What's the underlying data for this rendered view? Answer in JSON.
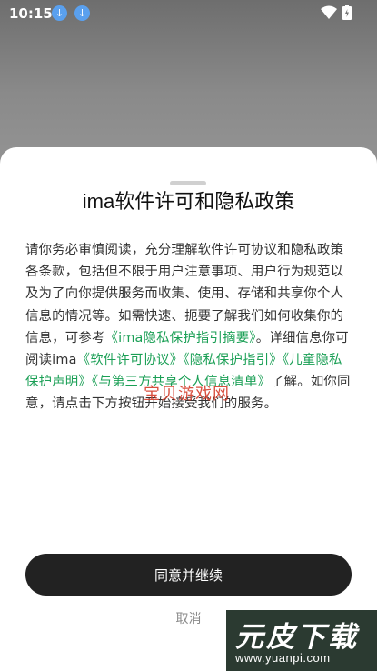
{
  "status_bar": {
    "time": "10:15",
    "icons": [
      "download-icon",
      "download-icon",
      "wifi-icon",
      "battery-icon"
    ]
  },
  "dialog": {
    "title": "ima软件许可和隐私政策",
    "body": {
      "intro": "请你务必审慎阅读，充分理解软件许可协议和隐私政策各条款，包括但不限于用户注意事项、用户行为规范以及为了向你提供服务而收集、使用、存储和共享你个人信息的情况等。如需快速、扼要了解我们如何收集你的信息，可参考",
      "link_summary": "《ima隐私保护指引摘要》",
      "mid": "。详细信息你可阅读ima",
      "link_license": "《软件许可协议》",
      "link_privacy": "《隐私保护指引》",
      "link_children": "《儿童隐私保护声明》",
      "link_thirdparty": "《与第三方共享个人信息清单》",
      "outro": "了解。如你同意，请点击下方按钮开始接受我们的服务。"
    },
    "agree_button": "同意并继续",
    "cancel_button": "取消"
  },
  "watermark": "宝贝游戏网",
  "site_logo": {
    "name": "元皮下载",
    "url": "www.yuanpi.com"
  },
  "colors": {
    "link": "#1a9f55",
    "button_bg": "#222222",
    "scrim": "#8a8a8a"
  }
}
